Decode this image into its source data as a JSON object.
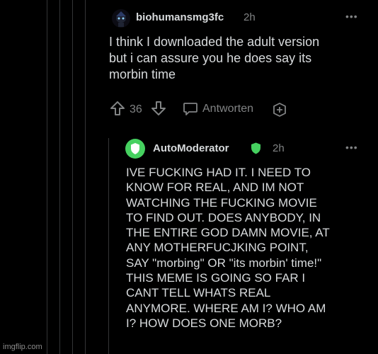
{
  "comment": {
    "username": "biohumansmg3fc",
    "time": "2h",
    "menu": "•••",
    "body": "I think I downloaded the adult version\nbut i can assure you he does say its\nmorbin time",
    "score": "36",
    "reply_label": "Antworten"
  },
  "reply": {
    "username": "AutoModerator",
    "time": "2h",
    "menu": "•••",
    "body": "IVE FUCKING HAD IT. I NEED TO\nKNOW FOR REAL, AND IM NOT\nWATCHING THE FUCKING MOVIE\nTO FIND OUT. DOES ANYBODY, IN\nTHE ENTIRE GOD DAMN MOVIE, AT\nANY MOTHERFUCJKING POINT,\nSAY \"morbing\" OR \"its morbin' time!\"\nTHIS MEME IS GOING SO FAR I\nCANT TELL WHATS REAL\nANYMORE. WHERE AM I? WHO AM\nI? HOW DOES ONE MORB?"
  },
  "watermark": "imgflip.com",
  "colors": {
    "background": "#000000",
    "text": "#d7dadc",
    "muted": "#818384",
    "mod_green": "#46d160"
  }
}
